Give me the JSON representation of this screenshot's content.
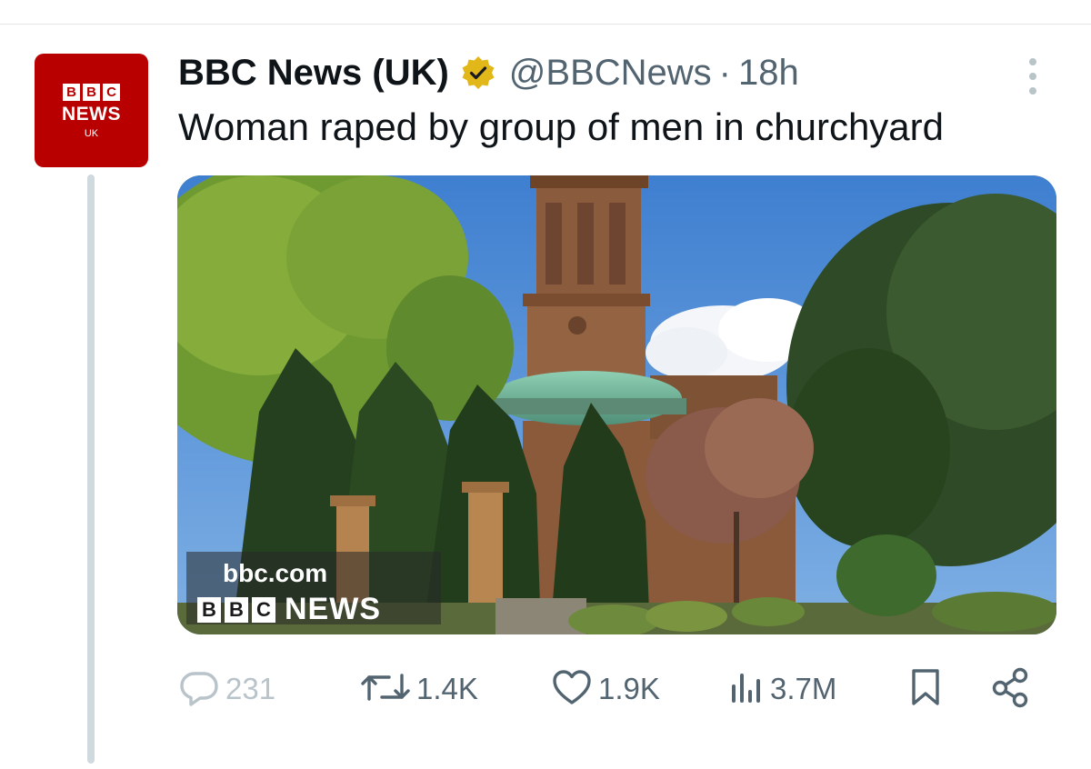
{
  "author": {
    "display_name": "BBC News (UK)",
    "handle": "@BBCNews",
    "separator": "·",
    "time": "18h",
    "verified_badge_color": "#e2b719",
    "avatar": {
      "blocks": [
        "B",
        "B",
        "C"
      ],
      "line1": "NEWS",
      "line2": "UK",
      "background": "#b80000"
    }
  },
  "tweet": {
    "text": "Woman raped by group of men in churchyard"
  },
  "media": {
    "watermark_url": "bbc.com",
    "watermark_blocks": [
      "B",
      "B",
      "C"
    ],
    "watermark_label": "NEWS"
  },
  "actions": {
    "replies": "231",
    "reposts": "1.4K",
    "likes": "1.9K",
    "views": "3.7M"
  },
  "icons": [
    "more-icon",
    "verified-icon",
    "reply-icon",
    "repost-icon",
    "like-icon",
    "views-icon",
    "bookmark-icon",
    "share-icon"
  ],
  "colors": {
    "text_primary": "#0f1419",
    "text_secondary": "#536471",
    "thread_line": "#cfd9de"
  }
}
